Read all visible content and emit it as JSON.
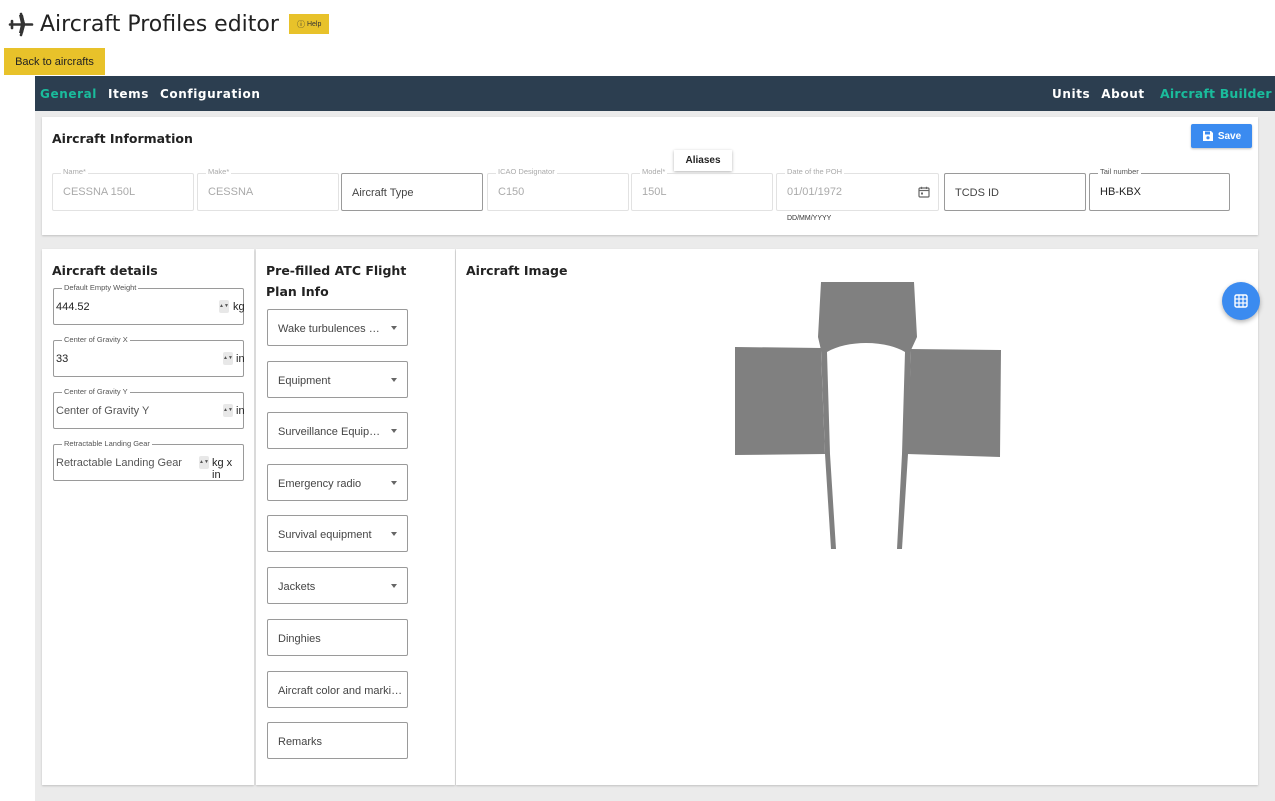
{
  "header": {
    "title": "Aircraft Profiles editor",
    "help_label": "Help",
    "back_label": "Back to aircrafts"
  },
  "navbar": {
    "left_items": [
      "General",
      "Items",
      "Configuration"
    ],
    "active": "General",
    "right_items": [
      "Units",
      "About"
    ],
    "brand": "Aircraft Builder"
  },
  "info": {
    "title": "Aircraft Information",
    "save_label": "Save",
    "aliases_label": "Aliases",
    "fields": {
      "name": {
        "label": "Name*",
        "value": "CESSNA 150L"
      },
      "make": {
        "label": "Make*",
        "value": "CESSNA"
      },
      "aircraft_type": {
        "placeholder": "Aircraft Type"
      },
      "icao": {
        "label": "ICAO Designator",
        "value": "C150"
      },
      "model": {
        "label": "Model*",
        "value": "150L"
      },
      "poh_date": {
        "label": "Date of the POH",
        "value": "01/01/1972",
        "hint": "DD/MM/YYYY"
      },
      "tcds": {
        "placeholder": "TCDS ID"
      },
      "tail": {
        "label": "Tail number",
        "value": "HB-KBX"
      }
    }
  },
  "details": {
    "title": "Aircraft details",
    "fields": [
      {
        "label": "Default Empty Weight",
        "value": "444.52",
        "unit": "kg"
      },
      {
        "label": "Center of Gravity X",
        "value": "33",
        "unit": "in"
      },
      {
        "label": "Center of Gravity Y",
        "value": "Center of Gravity Y",
        "unit": "in"
      },
      {
        "label": "Retractable Landing Gear",
        "value": "Retractable Landing Gear",
        "unit": "kg x in"
      }
    ]
  },
  "atc": {
    "title": "Pre-filled ATC Flight Plan Info",
    "fields": [
      {
        "text": "Wake turbulences category",
        "dropdown": true
      },
      {
        "text": "Equipment",
        "dropdown": true
      },
      {
        "text": "Surveillance Equipment",
        "dropdown": true
      },
      {
        "text": "Emergency radio",
        "dropdown": true
      },
      {
        "text": "Survival equipment",
        "dropdown": true
      },
      {
        "text": "Jackets",
        "dropdown": true
      },
      {
        "text": "Dinghies",
        "dropdown": false
      },
      {
        "text": "Aircraft color and markings",
        "dropdown": false
      },
      {
        "text": "Remarks",
        "dropdown": false
      }
    ]
  },
  "image_panel": {
    "title": "Aircraft Image",
    "fab_icon": "grid-icon"
  },
  "colors": {
    "navbar_bg": "#2c3e50",
    "accent": "#1abc9c",
    "button_yellow": "#e8c22a",
    "primary_blue": "#3b8bf0",
    "aircraft_gray": "#808080"
  }
}
